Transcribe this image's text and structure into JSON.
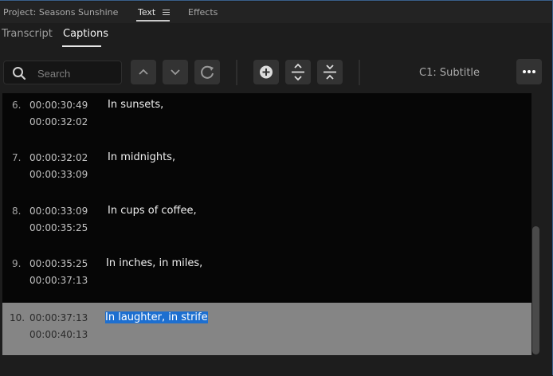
{
  "panel_tabs": {
    "project": "Project: Seasons Sunshine",
    "text": "Text",
    "effects": "Effects"
  },
  "sub_tabs": {
    "transcript": "Transcript",
    "captions": "Captions"
  },
  "toolbar": {
    "search_placeholder": "Search",
    "search_value": "",
    "track_label": "C1: Subtitle",
    "buttons": [
      "chevron-up-icon",
      "chevron-down-icon",
      "refresh-icon",
      "add-icon",
      "merge-icon",
      "split-icon",
      "more-icon"
    ]
  },
  "captions": [
    {
      "index": "6.",
      "in": "00:00:30:49",
      "out": "00:00:32:02",
      "text": "In sunsets,"
    },
    {
      "index": "7.",
      "in": "00:00:32:02",
      "out": "00:00:33:09",
      "text": "In midnights,"
    },
    {
      "index": "8.",
      "in": "00:00:33:09",
      "out": "00:00:35:25",
      "text": "In cups of coffee,"
    },
    {
      "index": "9.",
      "in": "00:00:35:25",
      "out": "00:00:37:13",
      "text": "In inches, in miles,"
    },
    {
      "index": "10.",
      "in": "00:00:37:13",
      "out": "00:00:40:13",
      "text": "In laughter, in strife",
      "selected": true
    }
  ],
  "colors": {
    "accent_selection": "#1d6fd0",
    "selected_row": "#858585",
    "panel_bg": "#1d1d1d"
  }
}
